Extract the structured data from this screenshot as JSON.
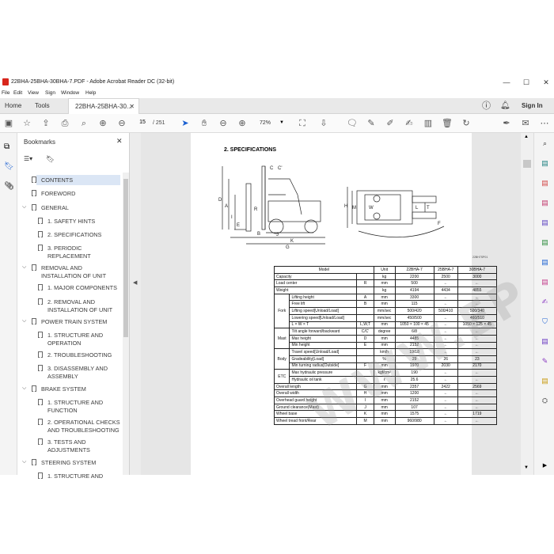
{
  "window": {
    "title": "22BHA-25BHA-30BHA-7.PDF - Adobe Acrobat Reader DC (32-bit)",
    "min": "—",
    "max": "☐",
    "close": "✕"
  },
  "menu": [
    "File",
    "Edit",
    "View",
    "Sign",
    "Window",
    "Help"
  ],
  "tabs": {
    "home": "Home",
    "tools": "Tools",
    "doc": "22BHA-25BHA-30..."
  },
  "account": {
    "signin": "Sign In"
  },
  "toolbar": {
    "page_current": "15",
    "page_total": "/ 251",
    "zoom": "72%"
  },
  "bookmarks": {
    "title": "Bookmarks",
    "items": [
      {
        "label": "CONTENTS"
      },
      {
        "label": "FOREWORD"
      },
      {
        "label": "GENERAL"
      },
      {
        "label": "1. SAFETY HINTS"
      },
      {
        "label": "2. SPECIFICATIONS"
      },
      {
        "label": "3. PERIODIC REPLACEMENT"
      },
      {
        "label": "REMOVAL AND INSTALLATION OF UNIT"
      },
      {
        "label": "1. MAJOR COMPONENTS"
      },
      {
        "label": "2. REMOVAL AND INSTALLATION OF UNIT"
      },
      {
        "label": "POWER TRAIN SYSTEM"
      },
      {
        "label": "1. STRUCTURE AND OPERATION"
      },
      {
        "label": "2. TROUBLESHOOTING"
      },
      {
        "label": "3. DISASSEMBLY AND ASSEMBLY"
      },
      {
        "label": "BRAKE SYSTEM"
      },
      {
        "label": "1. STRUCTURE AND FUNCTION"
      },
      {
        "label": "2. OPERATIONAL CHECKS AND TROUBLESHOOTING"
      },
      {
        "label": "3. TESTS AND ADJUSTMENTS"
      },
      {
        "label": "STEERING SYSTEM"
      },
      {
        "label": "1. STRUCTURE AND"
      }
    ]
  },
  "document": {
    "heading": "2. SPECIFICATIONS",
    "drawing_code": "22BH7SP01",
    "watermark": "WWW.EPCDATA.COM",
    "table_header": [
      "Model",
      "Unit",
      "22BHA-7",
      "25BHA-7",
      "30BHA-7"
    ],
    "rows": [
      {
        "g": "",
        "item": "Capacity",
        "c": "",
        "unit": "kg",
        "a": "2200",
        "b": "2500",
        "d": "3000"
      },
      {
        "g": "",
        "item": "Load center",
        "c": "R",
        "unit": "mm",
        "a": "500",
        "b": "←",
        "d": "←"
      },
      {
        "g": "",
        "item": "Weight",
        "c": "",
        "unit": "kg",
        "a": "4194",
        "b": "4434",
        "d": "4855"
      },
      {
        "g": "Fork",
        "item": "Lifting height",
        "c": "A",
        "unit": "mm",
        "a": "3300",
        "b": "←",
        "d": "←"
      },
      {
        "g": "",
        "item": "Free lift",
        "c": "B",
        "unit": "mm",
        "a": "115",
        "b": "←",
        "d": "←"
      },
      {
        "g": "",
        "item": "Lifting speed[Unload/Load]",
        "c": "",
        "unit": "mm/sec",
        "a": "500/420",
        "b": "500/410",
        "d": "500/340"
      },
      {
        "g": "",
        "item": "Lowering speed[Unload/Load]",
        "c": "",
        "unit": "mm/sec",
        "a": "450/500",
        "b": "←",
        "d": "460/510"
      },
      {
        "g": "",
        "item": "L × W × T",
        "c": "L,W,T",
        "unit": "mm",
        "a": "1050 × 100 × 45",
        "b": "←",
        "d": "1050 × 125 × 45"
      },
      {
        "g": "Mast",
        "item": "Tilt angle forward/backward",
        "c": "C/C'",
        "unit": "degree",
        "a": "6/8",
        "b": "←",
        "d": "←"
      },
      {
        "g": "",
        "item": "Max height",
        "c": "D",
        "unit": "mm",
        "a": "4485",
        "b": "←",
        "d": "←"
      },
      {
        "g": "",
        "item": "Min height",
        "c": "E",
        "unit": "mm",
        "a": "2152",
        "b": "←",
        "d": "←"
      },
      {
        "g": "Body",
        "item": "Travel speed[Unload/Load]",
        "c": "",
        "unit": "km/h",
        "a": "19/18",
        "b": "←",
        "d": "←"
      },
      {
        "g": "",
        "item": "Gradeability[Load]",
        "c": "",
        "unit": "%",
        "a": "29",
        "b": "26",
        "d": "23"
      },
      {
        "g": "",
        "item": "Min turning radius[Outside]",
        "c": "F",
        "unit": "mm",
        "a": "1970",
        "b": "2030",
        "d": "2170"
      },
      {
        "g": "ETC",
        "item": "Max hydraulic pressure",
        "c": "",
        "unit": "kgf/cm²",
        "a": "190",
        "b": "←",
        "d": "←"
      },
      {
        "g": "",
        "item": "Hydraulic oil tank",
        "c": "",
        "unit": "ℓ",
        "a": "25.6",
        "b": "←",
        "d": "←"
      },
      {
        "g": "",
        "item": "Overall length",
        "c": "G",
        "unit": "mm",
        "a": "2357",
        "b": "2422",
        "d": "2569"
      },
      {
        "g": "",
        "item": "Overall width",
        "c": "H",
        "unit": "mm",
        "a": "1200",
        "b": "←",
        "d": "←"
      },
      {
        "g": "",
        "item": "Overhead guard height",
        "c": "I",
        "unit": "mm",
        "a": "2152",
        "b": "←",
        "d": "←"
      },
      {
        "g": "",
        "item": "Ground clearance(Mast)",
        "c": "J",
        "unit": "mm",
        "a": "107",
        "b": "←",
        "d": "←"
      },
      {
        "g": "",
        "item": "Wheel base",
        "c": "K",
        "unit": "mm",
        "a": "1575",
        "b": "←",
        "d": "1719"
      },
      {
        "g": "",
        "item": "Wheel tread front/Rear",
        "c": "M",
        "unit": "mm",
        "a": "960/980",
        "b": "←",
        "d": "←"
      }
    ]
  }
}
